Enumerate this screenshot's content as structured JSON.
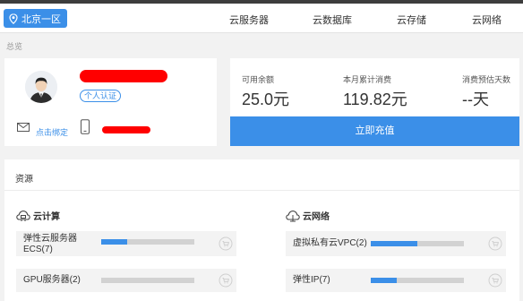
{
  "header": {
    "region": "北京一区",
    "nav": [
      "云服务器",
      "云数据库",
      "云存储",
      "云网络"
    ]
  },
  "breadcrumb": "总览",
  "profile": {
    "verify_badge": "个人认证",
    "bind_link": "点击绑定"
  },
  "balance": {
    "stats": [
      {
        "label": "可用余额",
        "value": "25.0元"
      },
      {
        "label": "本月累计消费",
        "value": "119.82元"
      },
      {
        "label": "消费预估天数",
        "value": "--天"
      }
    ],
    "recharge_label": "立即充值"
  },
  "resources": {
    "title": "资源",
    "compute": {
      "heading": "云计算",
      "items": [
        {
          "label": "弹性云服务器ECS(7)",
          "label_line1": "弹性云服务器",
          "label_line2": "ECS(7)",
          "level": 0.28
        },
        {
          "label": "GPU服务器(2)",
          "level": 0.0
        }
      ]
    },
    "network": {
      "heading": "云网络",
      "items": [
        {
          "label": "虚拟私有云VPC(2)",
          "level": 0.5
        },
        {
          "label": "弹性IP(7)",
          "level": 0.28
        }
      ]
    }
  },
  "colors": {
    "accent": "#3b8fe8",
    "redaction": "#ff0000",
    "bar_track": "#d2d2d2"
  }
}
